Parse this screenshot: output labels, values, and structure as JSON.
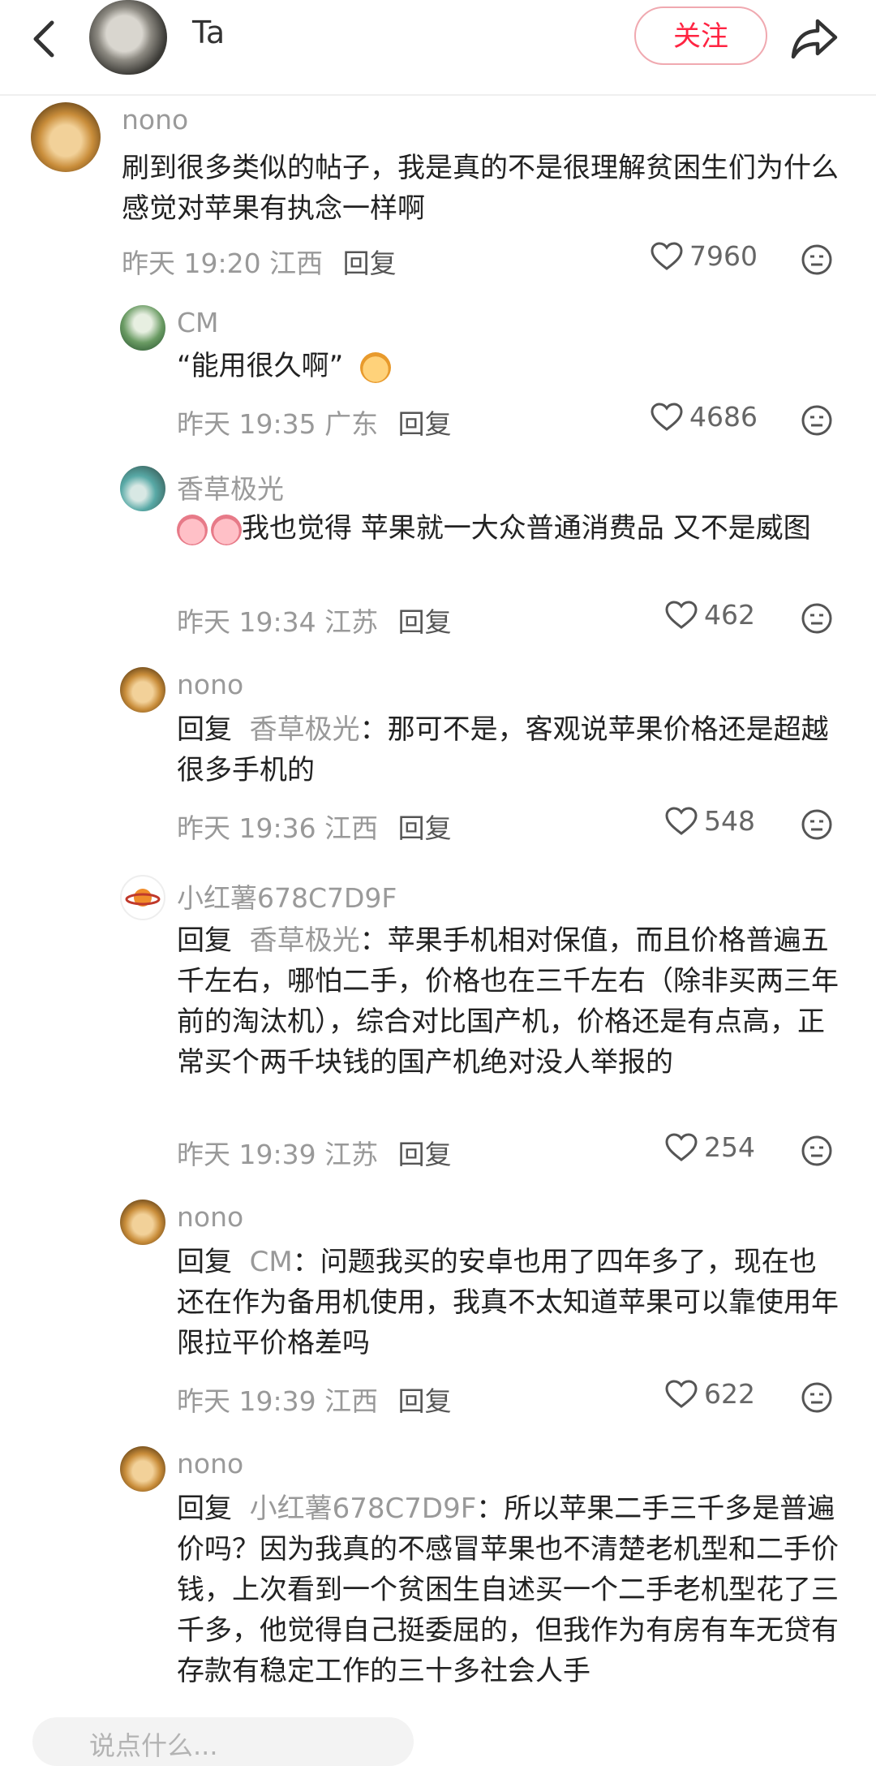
{
  "header": {
    "back_icon": "chevron-left-icon",
    "title": "Ta",
    "follow_label": "关注",
    "share_icon": "share-icon"
  },
  "comments": [
    {
      "user": "nono",
      "text": "刷到很多类似的帖子，我是真的不是很理解贫困生们为什么感觉对苹果有执念一样啊",
      "time": "昨天 19:20 江西",
      "reply": "回复",
      "likes": "7960"
    },
    {
      "user": "CM",
      "text": "“能用很久啊”",
      "time": "昨天 19:35 广东",
      "reply": "回复",
      "likes": "4686"
    },
    {
      "user": "香草极光",
      "text": "我也觉得 苹果就一大众普通消费品  又不是威图",
      "time": "昨天 19:34 江苏",
      "reply": "回复",
      "likes": "462"
    },
    {
      "user": "nono",
      "reply_kw": "回复",
      "reply_to": "香草极光",
      "text": "：那可不是，客观说苹果价格还是超越很多手机的",
      "time": "昨天 19:36 江西",
      "reply": "回复",
      "likes": "548"
    },
    {
      "user": "小红薯678C7D9F",
      "reply_kw": "回复",
      "reply_to": "香草极光",
      "text": "：苹果手机相对保值，而且价格普遍五千左右，哪怕二手，价格也在三千左右（除非买两三年前的淘汰机），综合对比国产机，价格还是有点高，正常买个两千块钱的国产机绝对没人举报的",
      "time": "昨天 19:39 江苏",
      "reply": "回复",
      "likes": "254"
    },
    {
      "user": "nono",
      "reply_kw": "回复",
      "reply_to": "CM",
      "text": "：问题我买的安卓也用了四年多了，现在也还在作为备用机使用，我真不太知道苹果可以靠使用年限拉平价格差吗",
      "time": "昨天 19:39 江西",
      "reply": "回复",
      "likes": "622"
    },
    {
      "user": "nono",
      "reply_kw": "回复",
      "reply_to": "小红薯678C7D9F",
      "text": "：所以苹果二手三千多是普遍价吗？因为我真的不感冒苹果也不清楚老机型和二手价钱，上次看到一个贫困生自述买一个二手老机型花了三千多，他觉得自己挺委屈的，但我作为有房有车无贷有存款有稳定工作的三十多社会人手"
    }
  ],
  "bottom": {
    "input_placeholder": "说点什么..."
  },
  "colors": {
    "accent": "#ff2442",
    "meta_gray": "#999999"
  }
}
